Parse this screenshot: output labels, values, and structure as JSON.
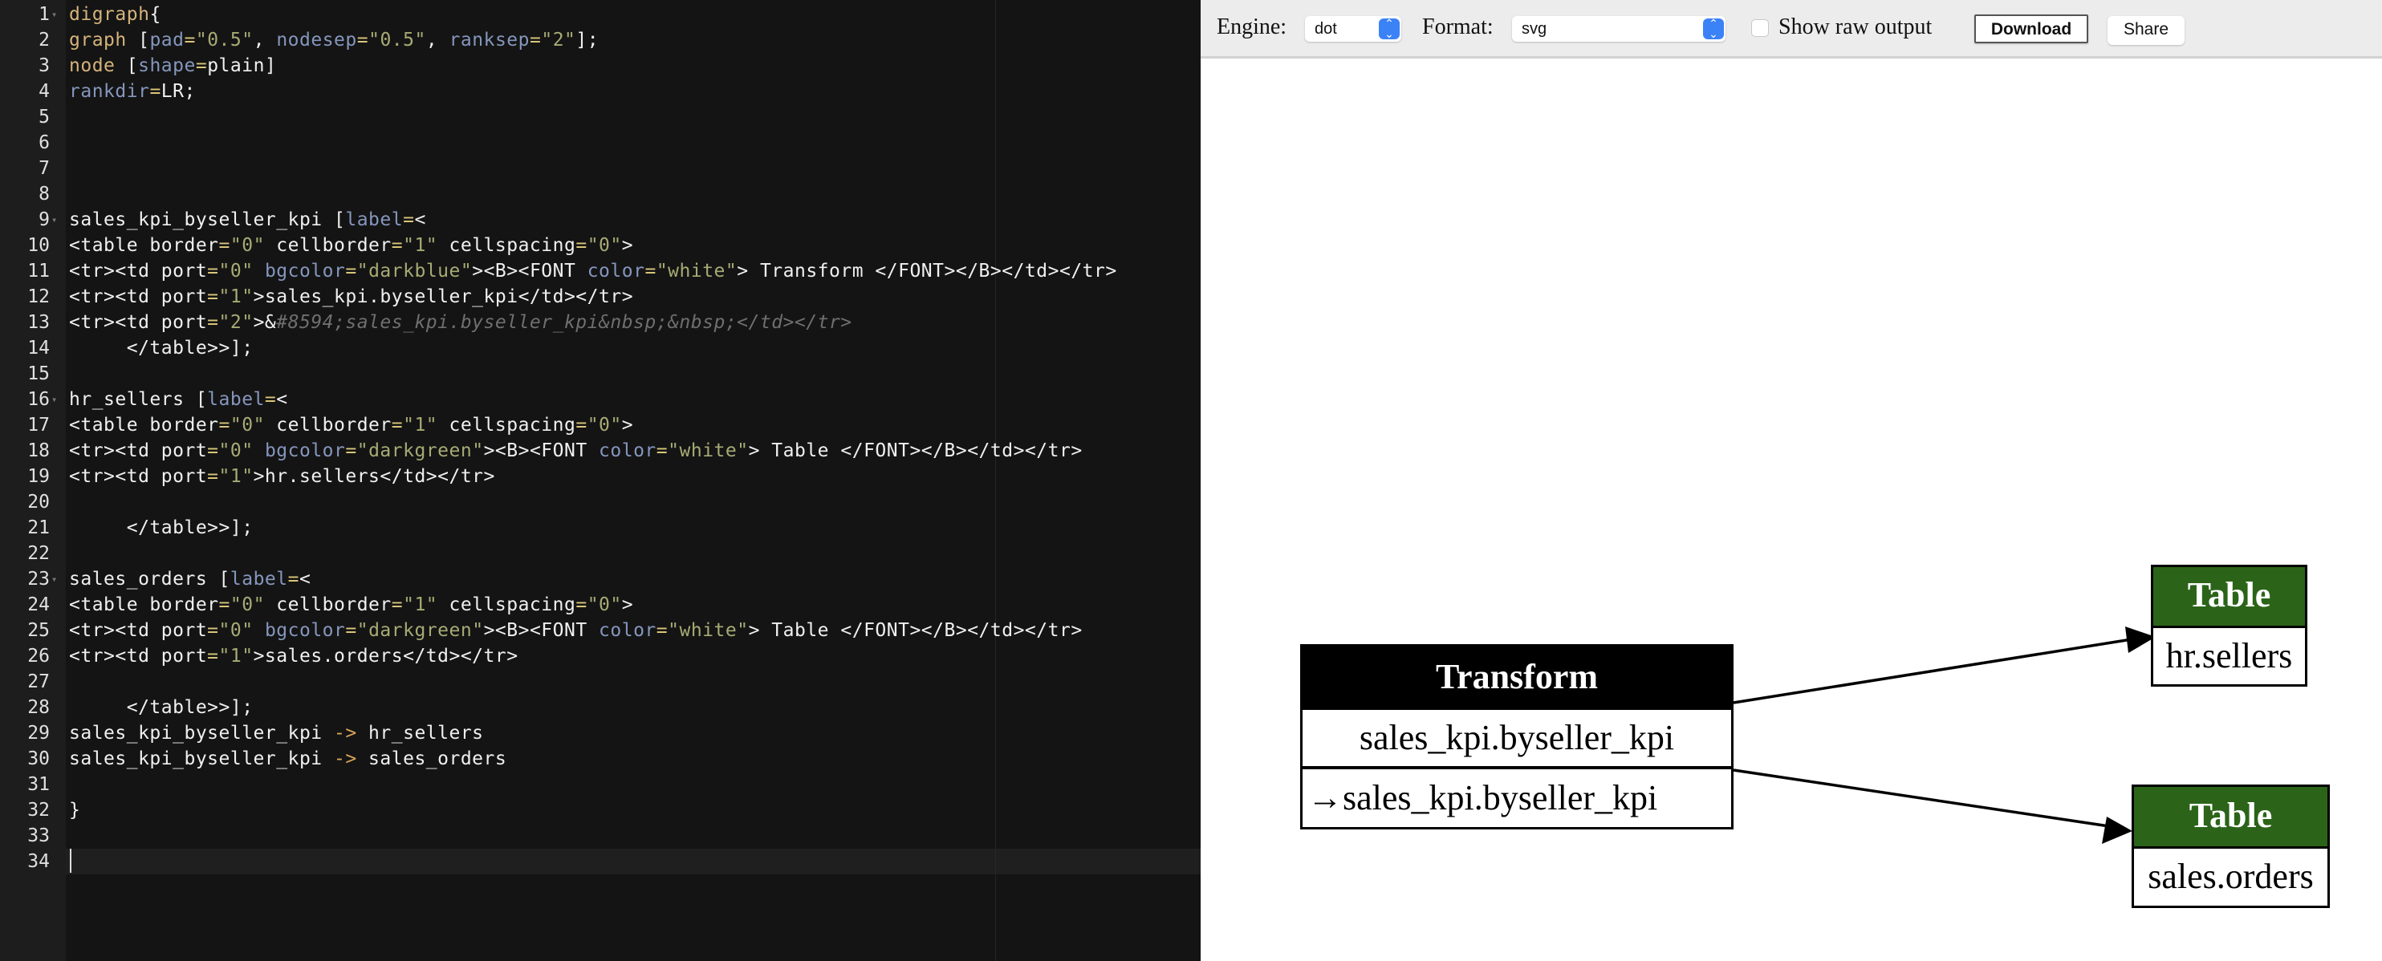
{
  "editor": {
    "line_numbers": [
      "1",
      "2",
      "3",
      "4",
      "5",
      "6",
      "7",
      "8",
      "9",
      "10",
      "11",
      "12",
      "13",
      "14",
      "15",
      "16",
      "17",
      "18",
      "19",
      "20",
      "21",
      "22",
      "23",
      "24",
      "25",
      "26",
      "27",
      "28",
      "29",
      "30",
      "31",
      "32",
      "33",
      "34"
    ],
    "fold_lines": [
      1,
      9,
      16,
      23
    ],
    "active_line": 34,
    "lines": [
      [
        [
          "kw",
          "digraph"
        ],
        [
          "",
          "{"
        ]
      ],
      [
        [
          "kw",
          "graph"
        ],
        [
          "",
          " ["
        ],
        [
          "at",
          "pad"
        ],
        [
          "op",
          "="
        ],
        [
          "st",
          "\"0.5\""
        ],
        [
          "",
          ", "
        ],
        [
          "at",
          "nodesep"
        ],
        [
          "op",
          "="
        ],
        [
          "st",
          "\"0.5\""
        ],
        [
          "",
          ", "
        ],
        [
          "at",
          "ranksep"
        ],
        [
          "op",
          "="
        ],
        [
          "st",
          "\"2\""
        ],
        [
          "",
          "];"
        ]
      ],
      [
        [
          "kw",
          "node"
        ],
        [
          "",
          " ["
        ],
        [
          "at",
          "shape"
        ],
        [
          "op",
          "="
        ],
        [
          "",
          "plain]"
        ]
      ],
      [
        [
          "at",
          "rankdir"
        ],
        [
          "op",
          "="
        ],
        [
          "",
          "LR;"
        ]
      ],
      [],
      [],
      [],
      [],
      [
        [
          "",
          "sales_kpi_byseller_kpi ["
        ],
        [
          "at",
          "label"
        ],
        [
          "op",
          "="
        ],
        [
          "",
          "<"
        ]
      ],
      [
        [
          "",
          "<table border"
        ],
        [
          "op",
          "="
        ],
        [
          "st",
          "\"0\""
        ],
        [
          "",
          " cellborder"
        ],
        [
          "op",
          "="
        ],
        [
          "st",
          "\"1\""
        ],
        [
          "",
          " cellspacing"
        ],
        [
          "op",
          "="
        ],
        [
          "st",
          "\"0\""
        ],
        [
          "",
          ">"
        ]
      ],
      [
        [
          "",
          "<tr><td port"
        ],
        [
          "op",
          "="
        ],
        [
          "st",
          "\"0\""
        ],
        [
          "",
          " "
        ],
        [
          "at",
          "bgcolor"
        ],
        [
          "op",
          "="
        ],
        [
          "st",
          "\"darkblue\""
        ],
        [
          "",
          "><B><FONT "
        ],
        [
          "at",
          "color"
        ],
        [
          "op",
          "="
        ],
        [
          "st",
          "\"white\""
        ],
        [
          "",
          "> Transform </FONT></B></td></tr>"
        ]
      ],
      [
        [
          "",
          "<tr><td port"
        ],
        [
          "op",
          "="
        ],
        [
          "st",
          "\"1\""
        ],
        [
          "",
          ">sales_kpi.byseller_kpi</td></tr>"
        ]
      ],
      [
        [
          "",
          "<tr><td port"
        ],
        [
          "op",
          "="
        ],
        [
          "st",
          "\"2\""
        ],
        [
          "",
          ">&"
        ],
        [
          "cm",
          "#8594;sales_kpi.byseller_kpi&nbsp;&nbsp;</td></tr>"
        ]
      ],
      [
        [
          "",
          "     </table>>];"
        ]
      ],
      [],
      [
        [
          "",
          "hr_sellers ["
        ],
        [
          "at",
          "label"
        ],
        [
          "op",
          "="
        ],
        [
          "",
          "<"
        ]
      ],
      [
        [
          "",
          "<table border"
        ],
        [
          "op",
          "="
        ],
        [
          "st",
          "\"0\""
        ],
        [
          "",
          " cellborder"
        ],
        [
          "op",
          "="
        ],
        [
          "st",
          "\"1\""
        ],
        [
          "",
          " cellspacing"
        ],
        [
          "op",
          "="
        ],
        [
          "st",
          "\"0\""
        ],
        [
          "",
          ">"
        ]
      ],
      [
        [
          "",
          "<tr><td port"
        ],
        [
          "op",
          "="
        ],
        [
          "st",
          "\"0\""
        ],
        [
          "",
          " "
        ],
        [
          "at",
          "bgcolor"
        ],
        [
          "op",
          "="
        ],
        [
          "st",
          "\"darkgreen\""
        ],
        [
          "",
          "><B><FONT "
        ],
        [
          "at",
          "color"
        ],
        [
          "op",
          "="
        ],
        [
          "st",
          "\"white\""
        ],
        [
          "",
          "> Table </FONT></B></td></tr>"
        ]
      ],
      [
        [
          "",
          "<tr><td port"
        ],
        [
          "op",
          "="
        ],
        [
          "st",
          "\"1\""
        ],
        [
          "",
          ">hr.sellers</td></tr>"
        ]
      ],
      [],
      [
        [
          "",
          "     </table>>];"
        ]
      ],
      [],
      [
        [
          "",
          "sales_orders ["
        ],
        [
          "at",
          "label"
        ],
        [
          "op",
          "="
        ],
        [
          "",
          "<"
        ]
      ],
      [
        [
          "",
          "<table border"
        ],
        [
          "op",
          "="
        ],
        [
          "st",
          "\"0\""
        ],
        [
          "",
          " cellborder"
        ],
        [
          "op",
          "="
        ],
        [
          "st",
          "\"1\""
        ],
        [
          "",
          " cellspacing"
        ],
        [
          "op",
          "="
        ],
        [
          "st",
          "\"0\""
        ],
        [
          "",
          ">"
        ]
      ],
      [
        [
          "",
          "<tr><td port"
        ],
        [
          "op",
          "="
        ],
        [
          "st",
          "\"0\""
        ],
        [
          "",
          " "
        ],
        [
          "at",
          "bgcolor"
        ],
        [
          "op",
          "="
        ],
        [
          "st",
          "\"darkgreen\""
        ],
        [
          "",
          "><B><FONT "
        ],
        [
          "at",
          "color"
        ],
        [
          "op",
          "="
        ],
        [
          "st",
          "\"white\""
        ],
        [
          "",
          "> Table </FONT></B></td></tr>"
        ]
      ],
      [
        [
          "",
          "<tr><td port"
        ],
        [
          "op",
          "="
        ],
        [
          "st",
          "\"1\""
        ],
        [
          "",
          ">sales.orders</td></tr>"
        ]
      ],
      [],
      [
        [
          "",
          "     </table>>];"
        ]
      ],
      [
        [
          "",
          "sales_kpi_byseller_kpi "
        ],
        [
          "ar",
          "->"
        ],
        [
          "",
          " hr_sellers"
        ]
      ],
      [
        [
          "",
          "sales_kpi_byseller_kpi "
        ],
        [
          "ar",
          "->"
        ],
        [
          "",
          " sales_orders"
        ]
      ],
      [],
      [
        [
          "",
          "}"
        ]
      ],
      [],
      []
    ]
  },
  "toolbar": {
    "engine_label": "Engine:",
    "engine_value": "dot",
    "format_label": "Format:",
    "format_value": "svg",
    "show_raw_label": "Show raw output",
    "show_raw_checked": false,
    "download_label": "Download",
    "share_label": "Share"
  },
  "graph": {
    "transform": {
      "header": "Transform",
      "row1": "sales_kpi.byseller_kpi",
      "row2": "→sales_kpi.byseller_kpi",
      "color": "#000000"
    },
    "hr_sellers": {
      "header": "Table",
      "row1": "hr.sellers",
      "color": "#2b6419"
    },
    "sales_orders": {
      "header": "Table",
      "row1": "sales.orders",
      "color": "#2b6419"
    }
  }
}
